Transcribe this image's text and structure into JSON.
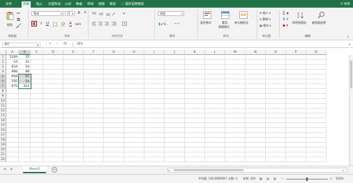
{
  "tabs": {
    "items": [
      "文件",
      "开始",
      "插入",
      "页面布局",
      "公式",
      "数据",
      "审阅",
      "视图",
      "帮助",
      "操作说明搜索"
    ],
    "share": "共享"
  },
  "ribbon": {
    "clipboard": {
      "paste": "粘贴",
      "group": "剪贴板"
    },
    "font": {
      "name": "等线",
      "size": "11",
      "bold": "B",
      "italic": "I",
      "underline": "U",
      "grow": "A",
      "shrink": "A",
      "color_letter": "A",
      "wen": "wén",
      "group": "字体"
    },
    "alignment": {
      "group": "对齐方式"
    },
    "number": {
      "format": "常规",
      "group": "数字"
    },
    "styles": {
      "cond": "条件格式",
      "table1": "套用",
      "table2": "表格格式",
      "cell": "单元格样式",
      "group": "样式"
    },
    "cells": {
      "insert": "插入",
      "delete": "删除",
      "format": "格式",
      "group": "单元格"
    },
    "editing": {
      "sort": "排序和筛选",
      "find": "查找和选择",
      "group": "编辑"
    }
  },
  "formula_bar": {
    "namebox": "B7",
    "fx": "fx",
    "value": "321"
  },
  "grid": {
    "columns": [
      "A",
      "B",
      "C",
      "D",
      "E",
      "F",
      "G",
      "H",
      "I",
      "J",
      "K",
      "L",
      "M",
      "N",
      "O",
      "P",
      "Q"
    ],
    "rows": [
      "1",
      "2",
      "3",
      "4",
      "5",
      "6",
      "7",
      "8",
      "9",
      "10",
      "11",
      "12",
      "13",
      "14",
      "15",
      "16",
      "17",
      "18",
      "19",
      "20",
      "21",
      "22"
    ],
    "data": [
      [
        "5249",
        "35"
      ],
      [
        "54",
        "22"
      ],
      [
        "654",
        "54"
      ],
      [
        "998",
        "98"
      ],
      [
        "958",
        "65"
      ],
      [
        "356",
        "54"
      ],
      [
        "975",
        "321"
      ]
    ]
  },
  "sheets": {
    "items": [
      "Sheet1"
    ],
    "add": "+"
  },
  "status": {
    "average": "平均值: 146.6666667",
    "count": "计数: 3",
    "sum": "求和: 440",
    "zoom": "100%"
  },
  "colors": {
    "accent": "#217346",
    "highlight": "#c00000"
  }
}
